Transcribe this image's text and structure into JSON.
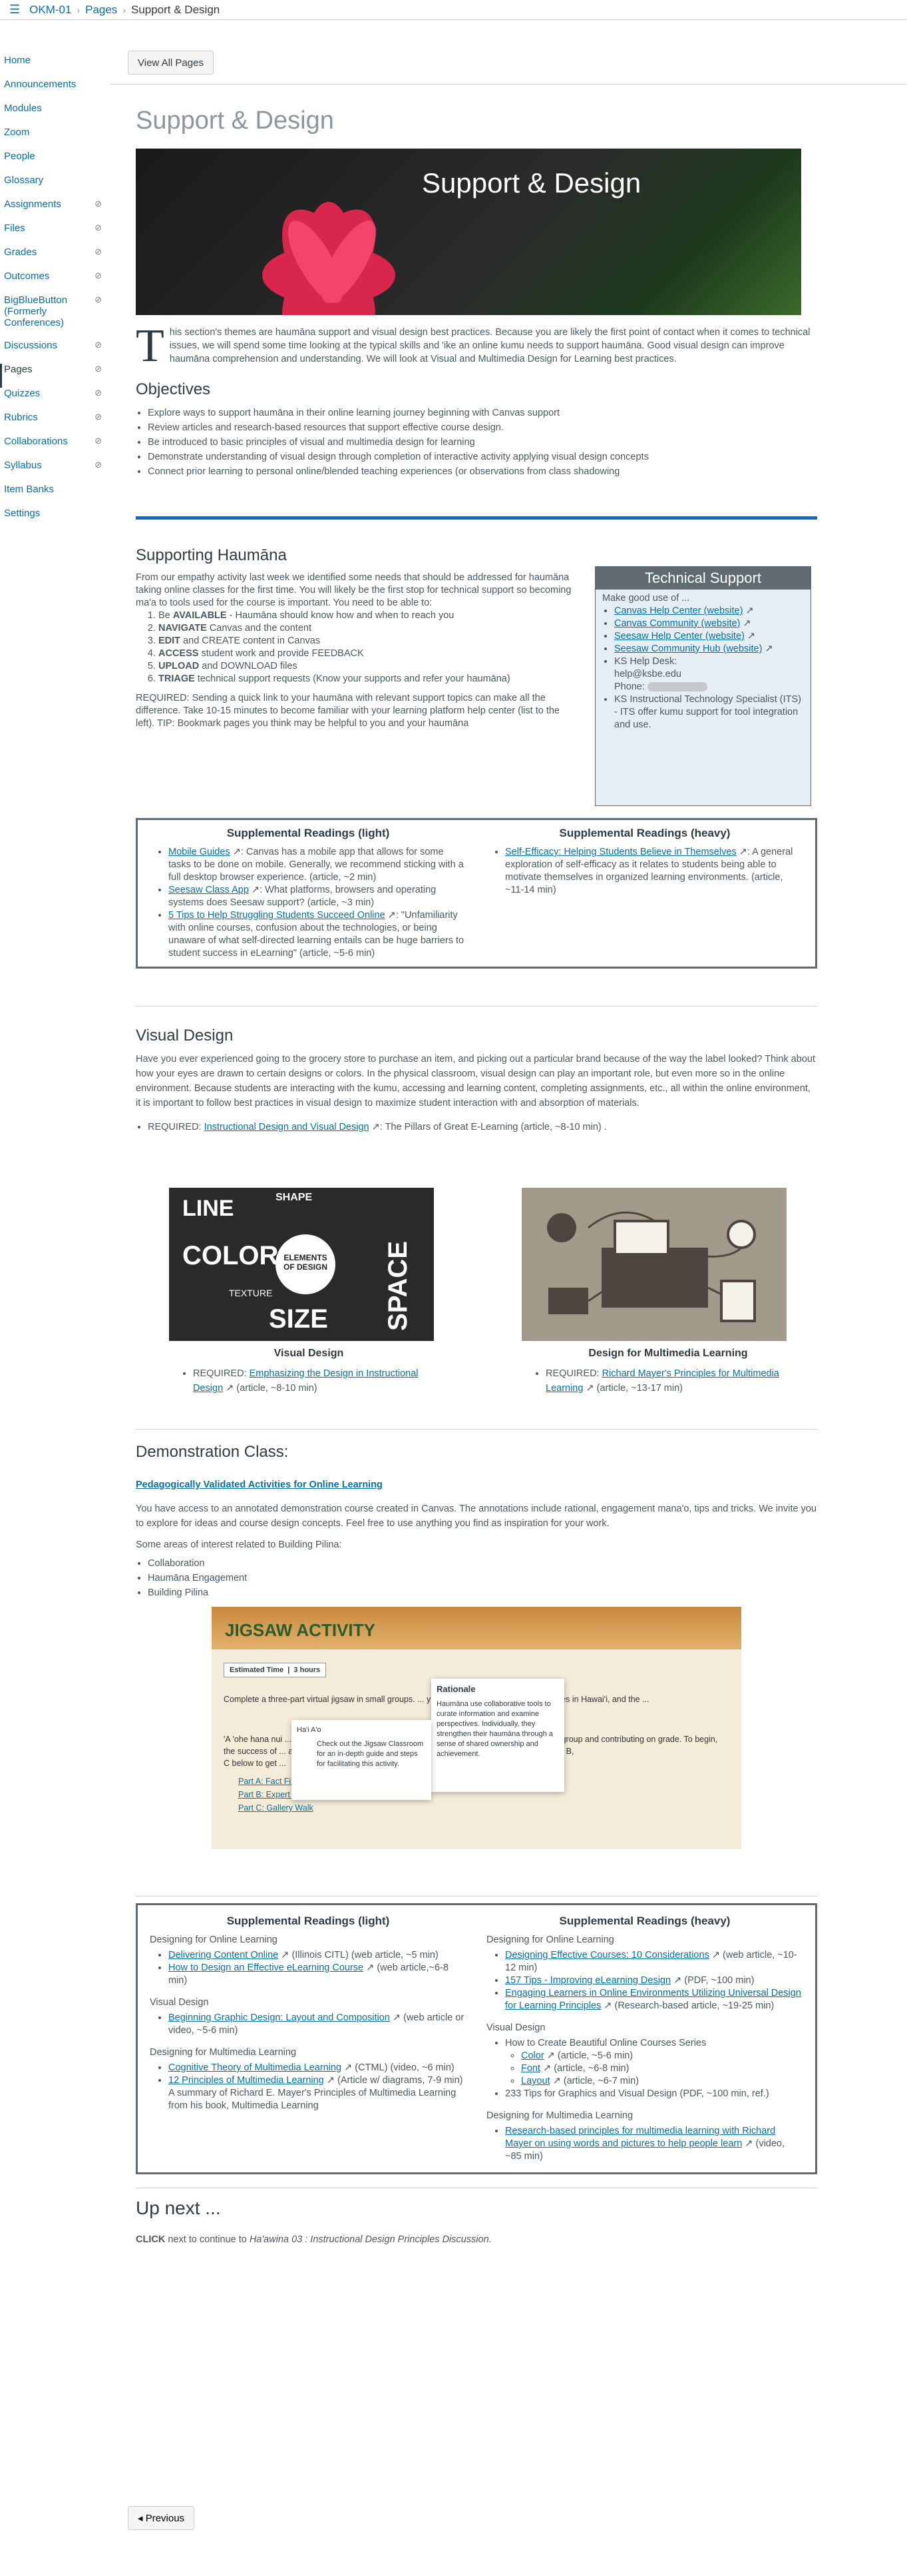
{
  "breadcrumb": {
    "course": "OKM-01",
    "pages": "Pages",
    "current": "Support & Design"
  },
  "sidebar": [
    {
      "label": "Home",
      "hidden": false
    },
    {
      "label": "Announcements",
      "hidden": false
    },
    {
      "label": "Modules",
      "hidden": false
    },
    {
      "label": "Zoom",
      "hidden": false
    },
    {
      "label": "People",
      "hidden": false
    },
    {
      "label": "Glossary",
      "hidden": false
    },
    {
      "label": "Assignments",
      "hidden": true
    },
    {
      "label": "Files",
      "hidden": true
    },
    {
      "label": "Grades",
      "hidden": true
    },
    {
      "label": "Outcomes",
      "hidden": true
    },
    {
      "label": "BigBlueButton (Formerly Conferences)",
      "hidden": true
    },
    {
      "label": "Discussions",
      "hidden": true
    },
    {
      "label": "Pages",
      "hidden": true
    },
    {
      "label": "Quizzes",
      "hidden": true
    },
    {
      "label": "Rubrics",
      "hidden": true
    },
    {
      "label": "Collaborations",
      "hidden": true
    },
    {
      "label": "Syllabus",
      "hidden": true
    },
    {
      "label": "Item Banks",
      "hidden": false
    },
    {
      "label": "Settings",
      "hidden": false
    }
  ],
  "view_all": "View All Pages",
  "page_title": "Support & Design",
  "banner_title": "Support & Design",
  "intro_dropcap": "T",
  "intro": "his section's themes are haumāna support and visual design best practices. Because you are likely the first point of contact when it comes to technical issues, we will spend some time looking at the typical skills and 'ike an online kumu needs to support haumāna. Good visual design can improve haumāna comprehension and understanding. We will look at Visual and Multimedia Design for Learning best practices.",
  "objectives_title": "Objectives",
  "objectives": [
    "Explore ways to support haumāna in their online learning journey beginning with Canvas support",
    "Review articles and research-based resources that support effective course design.",
    "Be introduced to basic principles of visual and multimedia design for learning",
    "Demonstrate understanding of visual design through completion of interactive activity applying visual design concepts",
    "Connect prior learning to personal online/blended teaching experiences (or observations from class shadowing"
  ],
  "supporting": {
    "title": "Supporting Haumāna",
    "intro": "From our empathy activity last week we identified some needs that should be addressed for haumāna taking online classes for the first time. You will likely be the first stop for technical support so becoming ma'a to tools used for the course is important. You need to be able to:",
    "items": [
      {
        "bold": "AVAILABLE",
        "pre": "Be ",
        "post": " - Haumāna should know how and when to reach you"
      },
      {
        "bold": "NAVIGATE",
        "pre": "",
        "post": " Canvas and the content"
      },
      {
        "bold": "EDIT",
        "pre": "",
        "post": " and CREATE content in Canvas"
      },
      {
        "bold": "ACCESS",
        "pre": "",
        "post": " student work and provide FEEDBACK"
      },
      {
        "bold": "UPLOAD",
        "pre": "",
        "post": " and DOWNLOAD files"
      },
      {
        "bold": "TRIAGE",
        "pre": "",
        "post": " technical support requests (Know your supports and refer your haumāna)"
      }
    ],
    "required": "REQUIRED: Sending a quick link to your haumāna with relevant support topics can make all the difference. Take 10-15 minutes to become familiar with your learning platform help center (list to the left). TIP: Bookmark pages you think may be helpful to you and your haumāna"
  },
  "tech_support": {
    "title": "Technical Support",
    "lead": "Make good use of ...",
    "links": [
      "Canvas Help Center (website)",
      "Canvas Community (website)",
      "Seesaw Help Center (website)",
      "Seesaw Community Hub (website)"
    ],
    "helpdesk": "KS Help Desk:",
    "email": "help@ksbe.edu",
    "phone": "Phone:",
    "specialist": "KS Instructional Technology Specialist (ITS) - ITS offer kumu support for tool integration and use."
  },
  "readings1": {
    "light_title": "Supplemental Readings (light)",
    "heavy_title": "Supplemental Readings (heavy)",
    "light": [
      {
        "link": "Mobile Guides",
        "text": ": Canvas has a mobile app that allows for some tasks to be done on mobile. Generally, we recommend sticking with a full desktop browser experience. (article, ~2 min)"
      },
      {
        "link": "Seesaw Class App",
        "text": ": What platforms, browsers and operating systems does Seesaw support? (article, ~3 min)"
      },
      {
        "link": "5 Tips to Help Struggling Students Succeed Online",
        "text": ": \"Unfamiliarity with online courses, confusion about the technologies, or being unaware of what self-directed learning entails can be huge barriers to student success in eLearning\" (article, ~5-6 min)"
      }
    ],
    "heavy": [
      {
        "link": "Self-Efficacy: Helping Students Believe in Themselves",
        "text": ": A general exploration of self-efficacy as it relates to students being able to motivate themselves in organized learning environments. (article, ~11-14 min)"
      }
    ]
  },
  "visual": {
    "title": "Visual Design",
    "text": "Have you ever experienced going to the grocery store to purchase an item, and picking out a particular brand because of the way the label looked? Think about how your eyes are drawn to certain designs or colors. In the physical classroom, visual design can play an important role, but even more so in the online environment. Because students are interacting with the kumu, accessing and learning content, completing assignments, etc., all within the online environment, it is important to follow best practices in visual design to maximize student interaction with and absorption of materials.",
    "req_pre": "REQUIRED: ",
    "req_link": "Instructional Design and Visual Design",
    "req_post": ": The Pillars of Great E-Learning (article, ~8-10 min) .",
    "img1_cap": "Visual Design",
    "img2_cap": "Design for Multimedia Learning",
    "img1_words": [
      "LINE",
      "SHAPE",
      "COLOR",
      "TEXTURE",
      "SIZE",
      "SPACE",
      "ELEMENTS",
      "OF DESIGN"
    ],
    "req1_link": "Emphasizing the Design in Instructional Design",
    "req1_post": "(article, ~8-10 min)",
    "req2_link": "Richard Mayer's Principles for Multimedia Learning",
    "req2_post": "(article, ~13-17 min)"
  },
  "demo": {
    "title": "Demonstration Class:",
    "link": "Pedagogically Validated Activities for Online Learning",
    "text": "You have access to an annotated demonstration course created in Canvas. The annotations include rational, engagement mana'o, tips and tricks. We invite you to explore for ideas and course design concepts. Feel free to use anything you find as inspiration for your work.",
    "areas_lead": "Some areas of interest related to Building Pilina:",
    "areas": [
      "Collaboration",
      "Haumāna Engagement",
      "Building Pilina"
    ],
    "jigsaw": {
      "title": "JIGSAW ACTIVITY",
      "est": "Estimated Time",
      "hours": "3 hours",
      "rationale": "Rationale",
      "rationale_text": "Haumāna use collaborative tools to curate information and examine perspectives. Individually, they strengthen their haumāna through a sense of shared ownership and achievement.",
      "line1": "Complete a three-part virtual jigsaw in small groups. ... y of knowledge on lawsuits, challenges in Hawai'i, and the ...",
      "haao": "Ha'i A'o",
      "haao_text": "Check out the Jigsaw Classroom for an in-depth guide and steps for facilitating this activity.",
      "para": "'A 'ohe hana nui ... to the success of ... and C below to get ...",
      "para2": "u are working as a group and contributing on grade. To begin, tab through parts A, B,",
      "parts": [
        "Part A: Fact Finding",
        "Part B: Expert Circle",
        "Part C: Gallery Walk"
      ]
    }
  },
  "readings2": {
    "light_title": "Supplemental Readings (light)",
    "heavy_title": "Supplemental Readings (heavy)",
    "light": [
      {
        "head": "Designing for Online Learning",
        "items": [
          {
            "link": "Delivering Content Online",
            "text": " (Illinois CITL) (web article, ~5 min)"
          },
          {
            "link": "How to Design an Effective eLearning Course",
            "text": " (web article,~6-8 min)"
          }
        ]
      },
      {
        "head": "Visual Design",
        "items": [
          {
            "link": "Beginning Graphic Design: Layout and Composition",
            "text": " (web article or video, ~5-6 min)"
          }
        ]
      },
      {
        "head": "Designing for Multimedia Learning",
        "items": [
          {
            "link": "Cognitive Theory of Multimedia Learning",
            "text": " (CTML) (video, ~6 min)"
          },
          {
            "link": "12 Principles of Multimedia Learning",
            "text": " (Article w/ diagrams, 7-9 min) A summary of Richard E. Mayer's Principles of Multimedia Learning from his book, Multimedia Learning"
          }
        ]
      }
    ],
    "heavy": [
      {
        "head": "Designing for Online Learning",
        "items": [
          {
            "link": "Designing Effective Courses: 10 Considerations",
            "text": " (web article, ~10-12 min)"
          },
          {
            "link": "157 Tips - Improving eLearning Design",
            "text": " (PDF, ~100 min)"
          },
          {
            "link": "Engaging Learners in Online Environments Utilizing Universal Design for Learning Principles",
            "text": " (Research-based article, ~19-25 min)"
          }
        ]
      },
      {
        "head": "Visual Design",
        "items": [
          {
            "link": "",
            "text": "How to Create Beautiful Online Courses Series"
          },
          {
            "link": "Color",
            "text": " (article, ~5-6 min)",
            "sub": true
          },
          {
            "link": "Font",
            "text": " (article, ~6-8 min)",
            "sub": true
          },
          {
            "link": "Layout",
            "text": " (article, ~6-7 min)",
            "sub": true
          },
          {
            "link": "",
            "text": "233 Tips for Graphics and Visual Design (PDF, ~100 min, ref.)"
          }
        ]
      },
      {
        "head": "Designing for Multimedia Learning",
        "items": [
          {
            "link": "Research-based principles for multimedia learning with Richard Mayer on using words and pictures to help people learn",
            "text": " (video, ~85 min)"
          }
        ]
      }
    ]
  },
  "upnext": {
    "title": "Up next ...",
    "click": "CLICK",
    "text": " next to continue to ",
    "target": "Ha'awina 03 : Instructional Design Principles Discussion."
  },
  "previous": "◂ Previous"
}
